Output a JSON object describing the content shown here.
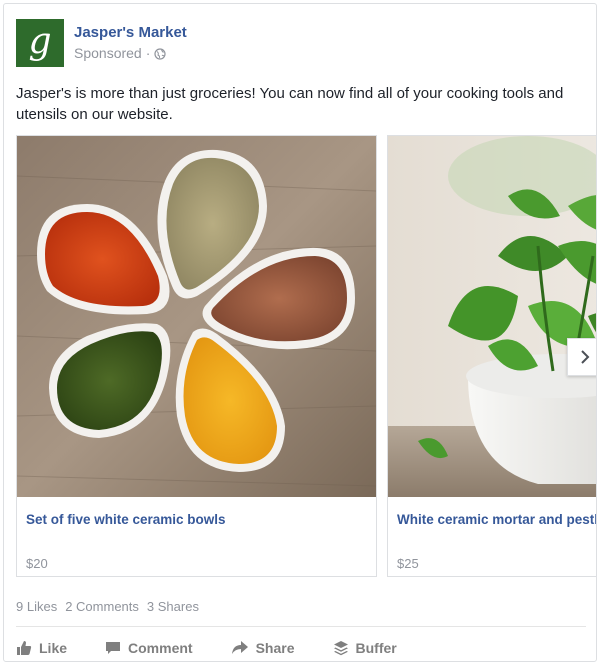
{
  "page": {
    "name": "Jasper's Market",
    "avatar_letter": "g",
    "sponsored_label": "Sponsored",
    "dot": "·",
    "brand_color": "#2e6b2c",
    "link_color": "#365899"
  },
  "message": "Jasper's is more than just groceries! You can now find all of your cooking tools and utensils on our website.",
  "carousel": {
    "cards": [
      {
        "title": "Set of five white ceramic bowls",
        "price": "$20",
        "image": "spice-bowls"
      },
      {
        "title": "White ceramic mortar and pestle",
        "price": "$25",
        "image": "mint-mortar"
      }
    ],
    "next_icon": "chevron-right-icon"
  },
  "stats": {
    "likes": "9 Likes",
    "comments": "2 Comments",
    "shares": "3 Shares"
  },
  "actions": {
    "like": "Like",
    "comment": "Comment",
    "share": "Share",
    "buffer": "Buffer"
  }
}
